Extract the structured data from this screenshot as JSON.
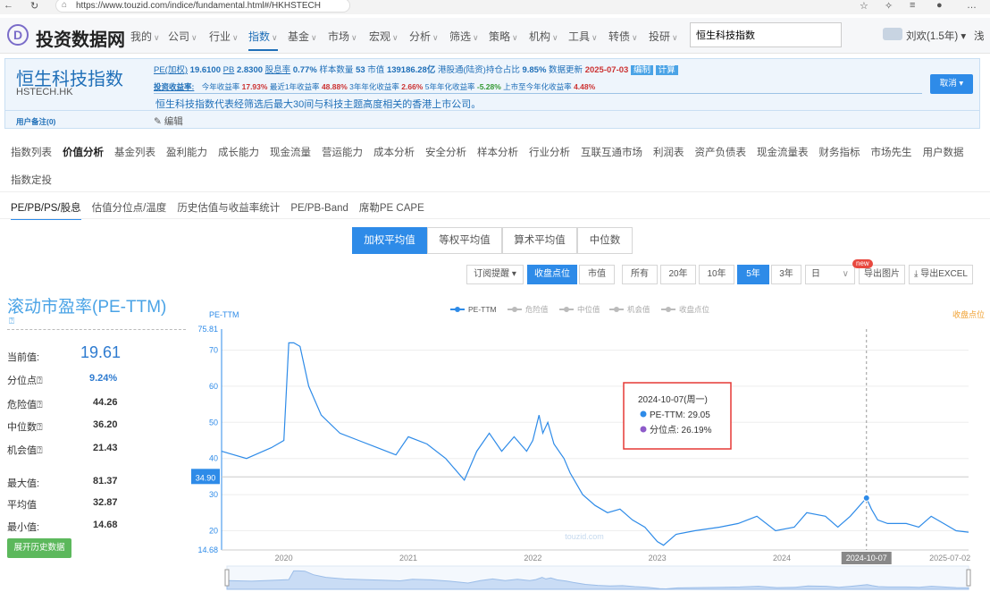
{
  "browser": {
    "url": "https://www.touzid.com/indice/fundamental.html#/HKHSTECH"
  },
  "site": {
    "logo": "D",
    "brand": "投资数据网",
    "nav": [
      "我的",
      "公司",
      "行业",
      "指数",
      "基金",
      "市场",
      "宏观",
      "分析",
      "筛选",
      "策略",
      "机构",
      "工具",
      "转债",
      "投研"
    ],
    "search_value": "恒生科技指数",
    "user": "刘欢(1.5年)",
    "extra": "浅"
  },
  "index": {
    "name": "恒生科技指数",
    "code": "HSTECH.HK",
    "pe_label": "PE(加权)",
    "pe": "19.6100",
    "pb_label": "PB",
    "pb": "2.8300",
    "dy_label": "股息率",
    "dy": "0.77%",
    "sample_label": "样本数量",
    "sample": "53",
    "mcap_label": "市值",
    "mcap": "139186.28亿",
    "hk_label": "港股通(陆资)持仓占比",
    "hk": "9.85%",
    "upd_label": "数据更新",
    "upd": "2025-07-03",
    "edit_badge": "编制",
    "calc_badge": "计算",
    "ret_title": "投资收益率:",
    "ret_ytd_label": "今年收益率",
    "ret_ytd": "17.93%",
    "ret_1y_label": "最近1年收益率",
    "ret_1y": "48.88%",
    "ret_3y_label": "3年年化收益率",
    "ret_3y": "2.66%",
    "ret_5y_label": "5年年化收益率",
    "ret_5y": "-5.28%",
    "ret_inc_label": "上市至今年化收益率",
    "ret_inc": "4.48%",
    "desc": "恒生科技指数代表经筛选后最大30间与科技主题高度相关的香港上市公司。",
    "cancel": "取消 ▾",
    "note_label": "用户备注(0)",
    "edit": "编辑"
  },
  "tabs1": [
    "指数列表",
    "价值分析",
    "基金列表",
    "盈利能力",
    "成长能力",
    "现金流量",
    "营运能力",
    "成本分析",
    "安全分析",
    "样本分析",
    "行业分析",
    "互联互通市场",
    "利润表",
    "资产负债表",
    "现金流量表",
    "财务指标",
    "市场先生",
    "用户数据"
  ],
  "tabs1_row2": "指数定投",
  "tabs2": [
    "PE/PB/PS/股息",
    "估值分位点/温度",
    "历史估值与收益率统计",
    "PE/PB-Band",
    "席勒PE CAPE"
  ],
  "avg_tabs": [
    "加权平均值",
    "等权平均值",
    "算术平均值",
    "中位数"
  ],
  "controls": {
    "subscribe": "订阅提醒 ▾",
    "close": "收盘点位",
    "mcap": "市值",
    "all": "所有",
    "y20": "20年",
    "y10": "10年",
    "y5": "5年",
    "y3": "3年",
    "period": "日",
    "new": "new",
    "export_img": "导出图片",
    "export_xls": "导出EXCEL"
  },
  "left": {
    "title": "滚动市盈率(PE-TTM)",
    "current_label": "当前值:",
    "current": "19.61",
    "pct_label": "分位点",
    "pct": "9.24%",
    "danger_label": "危险值",
    "danger": "44.26",
    "median_label": "中位数",
    "median": "36.20",
    "chance_label": "机会值",
    "chance": "21.43",
    "max_label": "最大值:",
    "max": "81.37",
    "avg_label": "平均值",
    "avg": "32.87",
    "min_label": "最小值:",
    "min": "14.68",
    "expand": "展开历史数据"
  },
  "chart_data": {
    "type": "line",
    "ylabel": "PE-TTM",
    "y2label": "收盘点位",
    "legend": [
      "PE-TTM",
      "危险值",
      "中位值",
      "机会值",
      "收盘点位"
    ],
    "ylim": [
      14.68,
      75.81
    ],
    "yticks": [
      20,
      30,
      40,
      50,
      60,
      70
    ],
    "ymin_label": "14.68",
    "ymax_label": "75.81",
    "xlabels": [
      "2020",
      "2021",
      "2022",
      "2023",
      "2024",
      "2025-07-02"
    ],
    "current_marker": "34.90",
    "cursor_label": "2024-10-07",
    "tooltip": {
      "date": "2024-10-07(周一)",
      "pe": "PE-TTM: 29.05",
      "pct": "分位点: 26.19%"
    },
    "watermark": "touzid.com",
    "series": [
      {
        "name": "PE-TTM",
        "x": [
          2019.5,
          2019.7,
          2019.9,
          2020.0,
          2020.04,
          2020.08,
          2020.13,
          2020.2,
          2020.3,
          2020.45,
          2020.6,
          2020.75,
          2020.9,
          2021.0,
          2021.15,
          2021.3,
          2021.45,
          2021.55,
          2021.65,
          2021.75,
          2021.85,
          2021.95,
          2022.0,
          2022.05,
          2022.08,
          2022.12,
          2022.17,
          2022.25,
          2022.3,
          2022.4,
          2022.5,
          2022.6,
          2022.7,
          2022.8,
          2022.9,
          2023.0,
          2023.05,
          2023.15,
          2023.3,
          2023.5,
          2023.65,
          2023.8,
          2023.95,
          2024.1,
          2024.2,
          2024.35,
          2024.45,
          2024.55,
          2024.68,
          2024.72,
          2024.77,
          2024.85,
          2025.0,
          2025.1,
          2025.2,
          2025.3,
          2025.4,
          2025.5
        ],
        "y": [
          42,
          40,
          43,
          45,
          72,
          72,
          71,
          60,
          52,
          47,
          45,
          43,
          41,
          46,
          44,
          40,
          34,
          42,
          47,
          42,
          46,
          42,
          45,
          52,
          47,
          50,
          44,
          40,
          36,
          30,
          27,
          25,
          26,
          23,
          21,
          17,
          16,
          19,
          20,
          21,
          22,
          24,
          20,
          21,
          25,
          24,
          21,
          24,
          29.05,
          26,
          23,
          22,
          22,
          21,
          24,
          22,
          20,
          19.61
        ]
      }
    ]
  }
}
